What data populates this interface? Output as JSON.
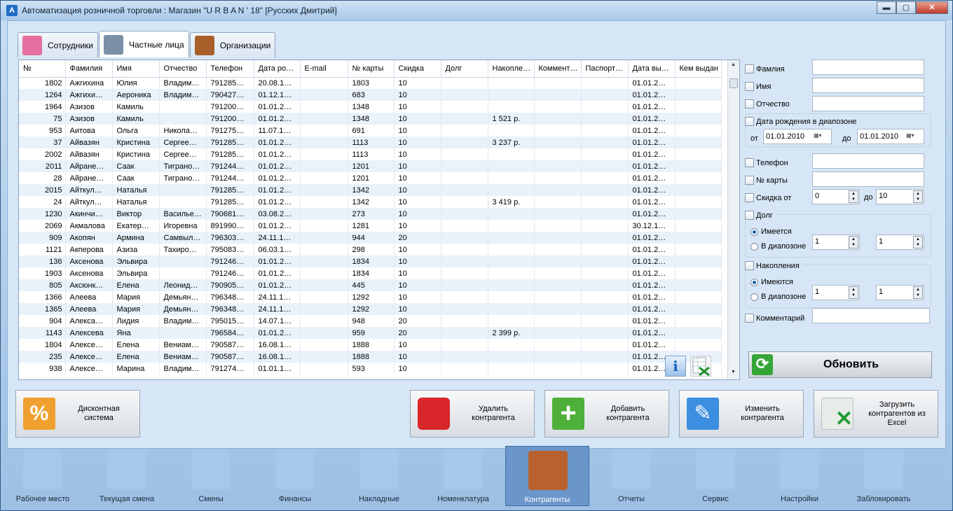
{
  "window": {
    "title": "Автоматизация розничной торговли : Магазин \"U R B A N ' 18\" [Русских Дмитрий]",
    "app_icon_letter": "A",
    "buttons": {
      "minimize": "▬",
      "maximize": "▢",
      "close": "✕"
    }
  },
  "tabs": [
    {
      "label": "Сотрудники",
      "icon": "employee-icon",
      "active": false
    },
    {
      "label": "Частные лица",
      "icon": "person-icon",
      "active": true
    },
    {
      "label": "Организации",
      "icon": "briefcase-icon",
      "active": false
    }
  ],
  "table": {
    "columns": [
      "№",
      "Фамилия",
      "Имя",
      "Отчество",
      "Телефон",
      "Дата ро…",
      "E-mail",
      "№ карты",
      "Скидка",
      "Долг",
      "Накопле…",
      "Коммент…",
      "Паспорт…",
      "Дата вы…",
      "Кем выдан"
    ],
    "rows": [
      [
        "1802",
        "Ажгихина",
        "Юлия",
        "Владим…",
        "791285…",
        "20.08.1…",
        "",
        "1803",
        "10",
        "",
        "",
        "",
        "",
        "01.01.2…",
        ""
      ],
      [
        "1264",
        "Ажгихи…",
        "Аероника",
        "Владим…",
        "790427…",
        "01.12.1…",
        "",
        "683",
        "10",
        "",
        "",
        "",
        "",
        "01.01.2…",
        ""
      ],
      [
        "1964",
        "Азизов",
        "Камиль",
        "",
        "791200…",
        "01.01.2…",
        "",
        "1348",
        "10",
        "",
        "",
        "",
        "",
        "01.01.2…",
        ""
      ],
      [
        "75",
        "Азизов",
        "Камиль",
        "",
        "791200…",
        "01.01.2…",
        "",
        "1348",
        "10",
        "",
        "1 521 р.",
        "",
        "",
        "01.01.2…",
        ""
      ],
      [
        "953",
        "Аитова",
        "Ольга",
        "Никола…",
        "791275…",
        "11.07.1…",
        "",
        "691",
        "10",
        "",
        "",
        "",
        "",
        "01.01.2…",
        ""
      ],
      [
        "37",
        "Айвазян",
        "Кристина",
        "Сергее…",
        "791285…",
        "01.01.2…",
        "",
        "1113",
        "10",
        "",
        "3 237 р.",
        "",
        "",
        "01.01.2…",
        ""
      ],
      [
        "2002",
        "Айвазян",
        "Кристина",
        "Сергее…",
        "791285…",
        "01.01.2…",
        "",
        "1113",
        "10",
        "",
        "",
        "",
        "",
        "01.01.2…",
        ""
      ],
      [
        "2011",
        "Айране…",
        "Саак",
        "Тиграно…",
        "791244…",
        "01.01.2…",
        "",
        "1201",
        "10",
        "",
        "",
        "",
        "",
        "01.01.2…",
        ""
      ],
      [
        "28",
        "Айране…",
        "Саак",
        "Тиграно…",
        "791244…",
        "01.01.2…",
        "",
        "1201",
        "10",
        "",
        "",
        "",
        "",
        "01.01.2…",
        ""
      ],
      [
        "2015",
        "Айткул…",
        "Наталья",
        "",
        "791285…",
        "01.01.2…",
        "",
        "1342",
        "10",
        "",
        "",
        "",
        "",
        "01.01.2…",
        ""
      ],
      [
        "24",
        "Айткул…",
        "Наталья",
        "",
        "791285…",
        "01.01.2…",
        "",
        "1342",
        "10",
        "",
        "3 419 р.",
        "",
        "",
        "01.01.2…",
        ""
      ],
      [
        "1230",
        "Акинчи…",
        "Виктор",
        "Василье…",
        "790681…",
        "03.08.2…",
        "",
        "273",
        "10",
        "",
        "",
        "",
        "",
        "01.01.2…",
        ""
      ],
      [
        "2069",
        "Акмалова",
        "Екатер…",
        "Игоревна",
        "891990…",
        "01.01.2…",
        "",
        "1281",
        "10",
        "",
        "",
        "",
        "",
        "30.12.1…",
        ""
      ],
      [
        "909",
        "Акопян",
        "Армина",
        "Самвыл…",
        "796303…",
        "24.11.1…",
        "",
        "944",
        "20",
        "",
        "",
        "",
        "",
        "01.01.2…",
        ""
      ],
      [
        "1121",
        "Акперова",
        "Азиза",
        "Тахиро…",
        "795083…",
        "06.03.1…",
        "",
        "298",
        "10",
        "",
        "",
        "",
        "",
        "01.01.2…",
        ""
      ],
      [
        "136",
        "Аксенова",
        "Эльвира",
        "",
        "791246…",
        "01.01.2…",
        "",
        "1834",
        "10",
        "",
        "",
        "",
        "",
        "01.01.2…",
        ""
      ],
      [
        "1903",
        "Аксенова",
        "Эльвира",
        "",
        "791246…",
        "01.01.2…",
        "",
        "1834",
        "10",
        "",
        "",
        "",
        "",
        "01.01.2…",
        ""
      ],
      [
        "805",
        "Аксюнк…",
        "Елена",
        "Леонид…",
        "790905…",
        "01.01.2…",
        "",
        "445",
        "10",
        "",
        "",
        "",
        "",
        "01.01.2…",
        ""
      ],
      [
        "1366",
        "Алеева",
        "Мария",
        "Демьян…",
        "796348…",
        "24.11.1…",
        "",
        "1292",
        "10",
        "",
        "",
        "",
        "",
        "01.01.2…",
        ""
      ],
      [
        "1365",
        "Алеева",
        "Мария",
        "Демьян…",
        "796348…",
        "24.11.1…",
        "",
        "1292",
        "10",
        "",
        "",
        "",
        "",
        "01.01.2…",
        ""
      ],
      [
        "904",
        "Алекса…",
        "Лидия",
        "Владим…",
        "795015…",
        "14.07.1…",
        "",
        "948",
        "20",
        "",
        "",
        "",
        "",
        "01.01.2…",
        ""
      ],
      [
        "1143",
        "Алексева",
        "Яна",
        "",
        "796584…",
        "01.01.2…",
        "",
        "959",
        "20",
        "",
        "2 399 р.",
        "",
        "",
        "01.01.2…",
        ""
      ],
      [
        "1804",
        "Алексе…",
        "Елена",
        "Вениам…",
        "790587…",
        "16.08.1…",
        "",
        "1888",
        "10",
        "",
        "",
        "",
        "",
        "01.01.2…",
        ""
      ],
      [
        "235",
        "Алексе…",
        "Елена",
        "Вениам…",
        "790587…",
        "16.08.1…",
        "",
        "1888",
        "10",
        "",
        "",
        "",
        "",
        "01.01.2…",
        ""
      ],
      [
        "938",
        "Алексе…",
        "Марина",
        "Владим…",
        "791274…",
        "01.01.1…",
        "",
        "593",
        "10",
        "",
        "",
        "",
        "",
        "01.01.2…",
        ""
      ]
    ]
  },
  "filters": {
    "surname": "Фамлия",
    "name": "Имя",
    "patronymic": "Отчество",
    "birth_range": "Дата рождения в диапозоне",
    "from_label": "от",
    "to_label": "до",
    "date_from": "01.01.2010",
    "date_to": "01.01.2010",
    "phone": "Телефон",
    "card": "№ карты",
    "discount": "Скидка от",
    "discount_from": "0",
    "discount_to_label": "до",
    "discount_to": "10",
    "debt": "Долг",
    "debt_has": "Имеется",
    "debt_range": "В диапозоне",
    "debt_from": "1",
    "debt_to": "1",
    "savings": "Накопления",
    "savings_has": "Имеются",
    "savings_range": "В диапозоне",
    "savings_from": "1",
    "savings_to": "1",
    "comment": "Комментарий",
    "refresh": "Обновить"
  },
  "actions": {
    "discount_system": "Дисконтная система",
    "delete": "Удалить контрагента",
    "add": "Добавить контрагента",
    "edit": "Изменить контрагента",
    "import": "Загрузить контрагентов из Excel"
  },
  "nav": [
    {
      "label": "Рабочее место",
      "icon": "workplace-icon"
    },
    {
      "label": "Текущая смена",
      "icon": "current-shift-icon"
    },
    {
      "label": "Смены",
      "icon": "shifts-icon"
    },
    {
      "label": "Финансы",
      "icon": "safe-icon"
    },
    {
      "label": "Накладные",
      "icon": "invoices-icon"
    },
    {
      "label": "Номенклатура",
      "icon": "nomenclature-icon"
    },
    {
      "label": "Контрагенты",
      "icon": "address-book-icon",
      "active": true
    },
    {
      "label": "Отчеты",
      "icon": "reports-icon"
    },
    {
      "label": "Сервис",
      "icon": "service-icon"
    },
    {
      "label": "Настройки",
      "icon": "settings-icon"
    },
    {
      "label": "Заблокировать",
      "icon": "lock-icon"
    }
  ]
}
